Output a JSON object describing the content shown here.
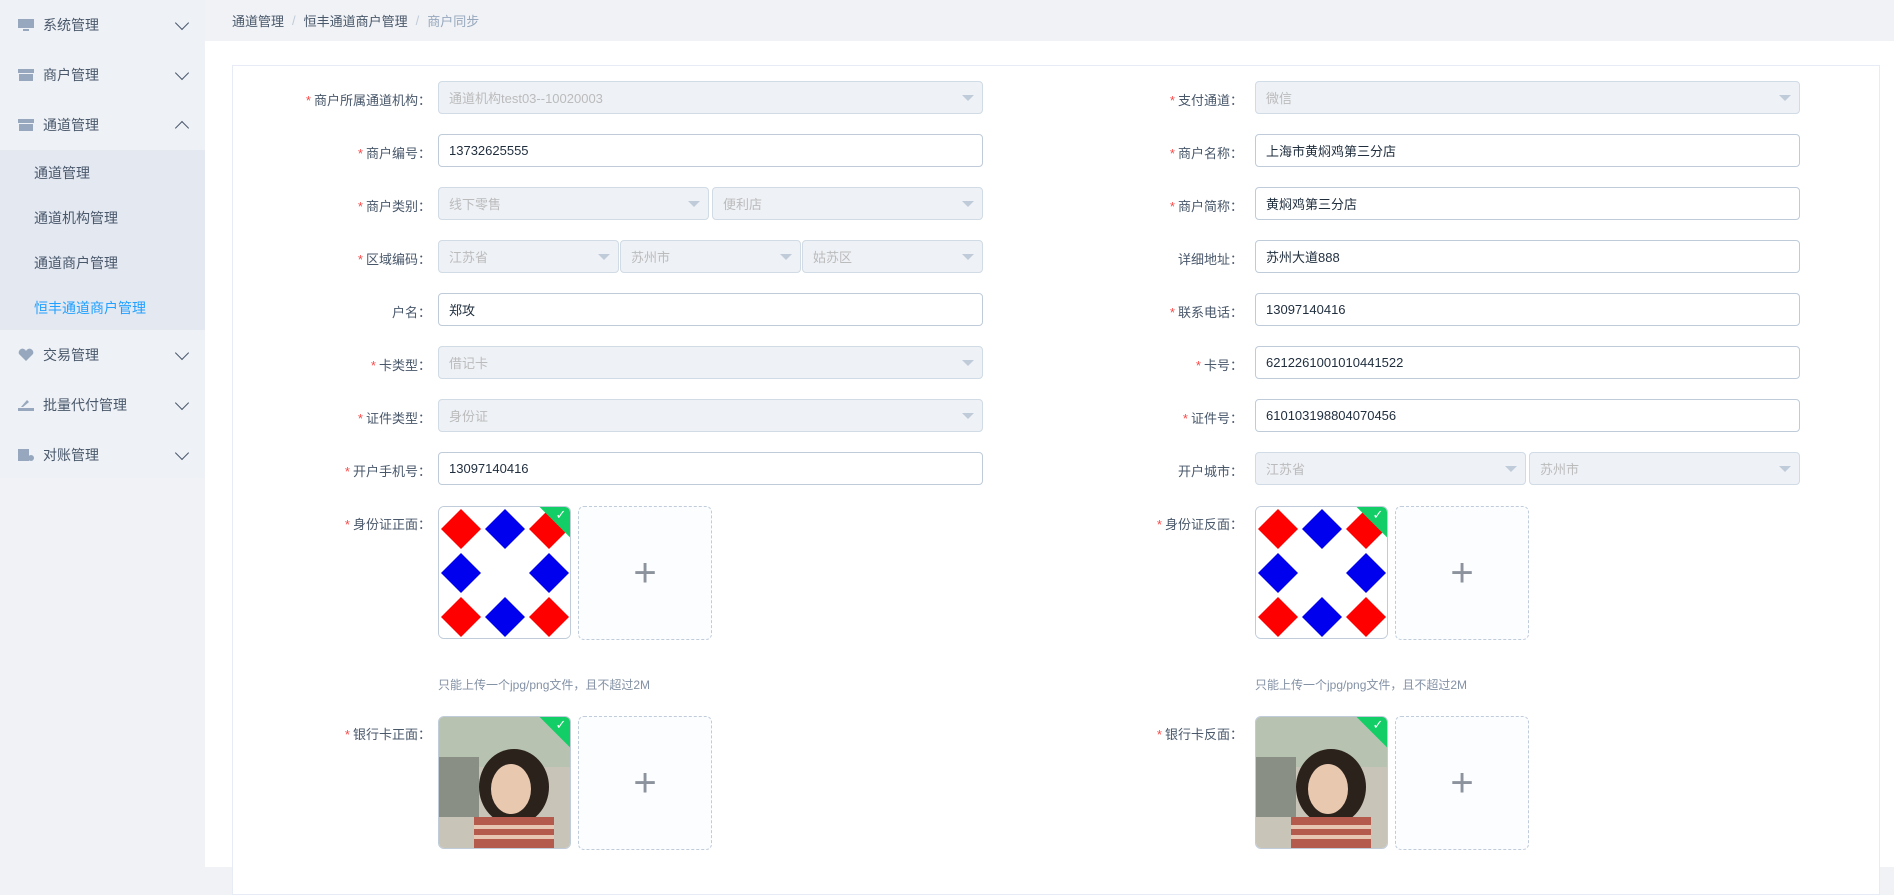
{
  "sidebar": {
    "items": [
      {
        "label": "系统管理",
        "icon": "monitor-icon"
      },
      {
        "label": "商户管理",
        "icon": "store-icon"
      },
      {
        "label": "通道管理",
        "icon": "store-icon",
        "expanded": true
      },
      {
        "label": "交易管理",
        "icon": "heart-icon"
      },
      {
        "label": "批量代付管理",
        "icon": "batch-pay-icon"
      },
      {
        "label": "对账管理",
        "icon": "reconcile-icon"
      }
    ],
    "submenu": [
      {
        "label": "通道管理"
      },
      {
        "label": "通道机构管理"
      },
      {
        "label": "通道商户管理"
      },
      {
        "label": "恒丰通道商户管理",
        "active": true
      }
    ]
  },
  "breadcrumb": [
    "通道管理",
    "恒丰通道商户管理",
    "商户同步"
  ],
  "form": {
    "left": {
      "org_label": "商户所属通道机构：",
      "org_value": "通道机构test03--10020003",
      "merchant_no_label": "商户编号：",
      "merchant_no_value": "13732625555",
      "category_label": "商户类别：",
      "category_value1": "线下零售",
      "category_value2": "便利店",
      "region_label": "区域编码：",
      "region_province": "江苏省",
      "region_city": "苏州市",
      "region_district": "姑苏区",
      "account_name_label": "户名：",
      "account_name_value": "郑攻",
      "card_type_label": "卡类型：",
      "card_type_value": "借记卡",
      "id_type_label": "证件类型：",
      "id_type_value": "身份证",
      "mobile_label": "开户手机号：",
      "mobile_value": "13097140416",
      "id_front_label": "身份证正面：",
      "bank_front_label": "银行卡正面：",
      "upload_tip": "只能上传一个jpg/png文件，且不超过2M"
    },
    "right": {
      "channel_label": "支付通道：",
      "channel_value": "微信",
      "merchant_name_label": "商户名称：",
      "merchant_name_value": "上海市黄焖鸡第三分店",
      "short_name_label": "商户简称：",
      "short_name_value": "黄焖鸡第三分店",
      "address_label": "详细地址：",
      "address_value": "苏州大道888",
      "phone_label": "联系电话：",
      "phone_value": "13097140416",
      "card_no_label": "卡号：",
      "card_no_value": "6212261001010441522",
      "id_no_label": "证件号：",
      "id_no_value": "610103198804070456",
      "open_city_label": "开户城市：",
      "open_province": "江苏省",
      "open_city": "苏州市",
      "id_back_label": "身份证反面：",
      "bank_back_label": "银行卡反面：",
      "upload_tip": "只能上传一个jpg/png文件，且不超过2M"
    }
  },
  "colors": {
    "accent": "#20a0ff",
    "success": "#13ce66",
    "required": "#ff4949",
    "diamond_red": "#ff0000",
    "diamond_blue": "#0000ee"
  }
}
